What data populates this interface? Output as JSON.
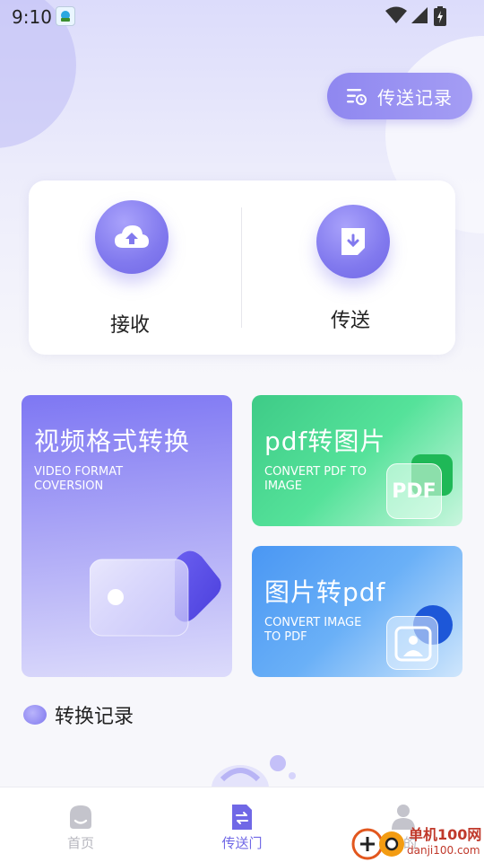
{
  "status_bar": {
    "time": "9:10"
  },
  "header": {
    "record_button_label": "传送记录"
  },
  "actions": {
    "receive_label": "接收",
    "send_label": "传送"
  },
  "tiles": [
    {
      "title": "视频格式转换",
      "subtitle_line1": "VIDEO FORMAT",
      "subtitle_line2": "COVERSION"
    },
    {
      "title": "pdf转图片",
      "subtitle_line1": "CONVERT PDF TO",
      "subtitle_line2": "IMAGE",
      "badge_text": "PDF"
    },
    {
      "title": "图片转pdf",
      "subtitle_line1": "CONVERT IMAGE",
      "subtitle_line2": "TO PDF"
    }
  ],
  "records": {
    "title": "转换记录"
  },
  "bottom_nav": [
    {
      "label": "首页",
      "active": false
    },
    {
      "label": "传送门",
      "active": true
    },
    {
      "label": "我的",
      "active": false
    }
  ],
  "watermark": {
    "brand": "单机100网",
    "url": "danji100.com"
  },
  "colors": {
    "accent": "#7f77ee",
    "nav_active": "#7068e6",
    "nav_inactive": "#b6b6be",
    "green": "#3ecb87",
    "blue": "#4a97f3"
  }
}
